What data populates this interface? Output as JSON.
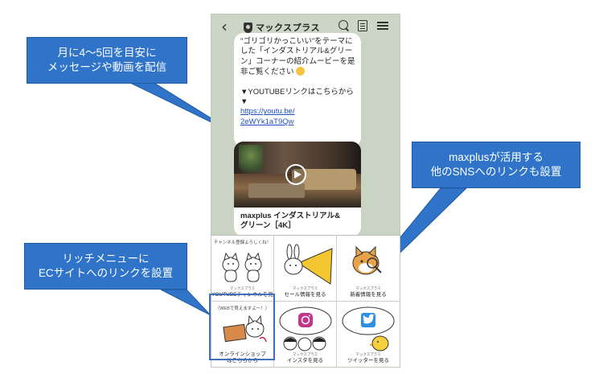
{
  "header": {
    "back_label": "‹",
    "account_name": "マックスプラス"
  },
  "message": {
    "lines": [
      "\"ゴリゴリかっこいい\"をテーマに",
      "した「インダストリアル&グリー",
      "ン」コーナーの紹介ムービーを是",
      "非ご覧ください"
    ],
    "youtube_lines": [
      "▼YOUTUBEリンクはこちらから",
      "▼"
    ],
    "link_lines": [
      "https://youtu.be/",
      "2eWYk1aT9Qw"
    ]
  },
  "video": {
    "title_lines": [
      "maxplus インダストリアル&",
      "グリーン［4K］"
    ]
  },
  "rich_menu": {
    "cells": [
      {
        "top": "チャンネル登録よろしくね！",
        "small": "マックスプラス",
        "label": "YOUTUBEチャンネルを見る"
      },
      {
        "top": "",
        "small": "マックスプラス",
        "label": "セール情報を見る"
      },
      {
        "top": "",
        "small": "マックスプラス",
        "label": "新着情報を見る"
      },
      {
        "top": "（WEBで買えますよ～！）",
        "small": "",
        "label": "オンラインショップはこちらから"
      },
      {
        "top": "",
        "small": "マックスプラス",
        "label": "インスタを見る"
      },
      {
        "top": "",
        "small": "マックスプラス",
        "label": "ツイッターを見る"
      }
    ]
  },
  "callouts": {
    "top_left": [
      "月に4～5回を目安に",
      "メッセージや動画を配信"
    ],
    "bottom_left": [
      "リッチメニューに",
      "ECサイトへのリンクを設置"
    ],
    "right": [
      "maxplusが活用する",
      "他のSNSへのリンクも設置"
    ]
  },
  "colors": {
    "callout_blue": "#2f74c9",
    "chat_background": "#c9d4c4",
    "link": "#1f4fbf"
  }
}
